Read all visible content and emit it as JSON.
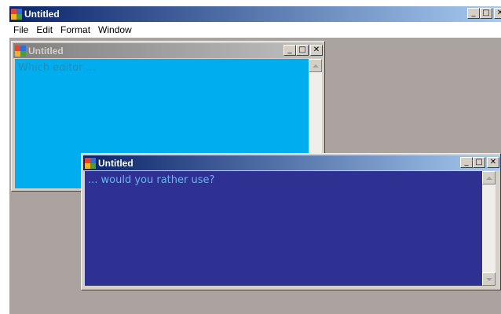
{
  "main_window": {
    "title": "Untitled",
    "controls": {
      "minimize": "_",
      "maximize": "□",
      "close": "✕"
    }
  },
  "menu": {
    "items": [
      {
        "label": "File"
      },
      {
        "label": "Edit"
      },
      {
        "label": "Format"
      },
      {
        "label": "Window"
      }
    ]
  },
  "child_windows": [
    {
      "title": "Untitled",
      "active": false,
      "text": "Which editor ...",
      "editor_bg": "#00aeef",
      "text_color": "#2a8ab0",
      "controls": {
        "minimize": "_",
        "maximize": "□",
        "close": "✕"
      }
    },
    {
      "title": "Untitled",
      "active": true,
      "text": "... would you rather use?",
      "editor_bg": "#2e3192",
      "text_color": "#6ab4f0",
      "controls": {
        "minimize": "_",
        "maximize": "□",
        "close": "✕"
      }
    }
  ],
  "colors": {
    "active_title_start": "#0a246a",
    "active_title_end": "#a6caf0",
    "inactive_title_start": "#808080",
    "inactive_title_end": "#c0c0c0",
    "mdi_background": "#aba39f"
  }
}
